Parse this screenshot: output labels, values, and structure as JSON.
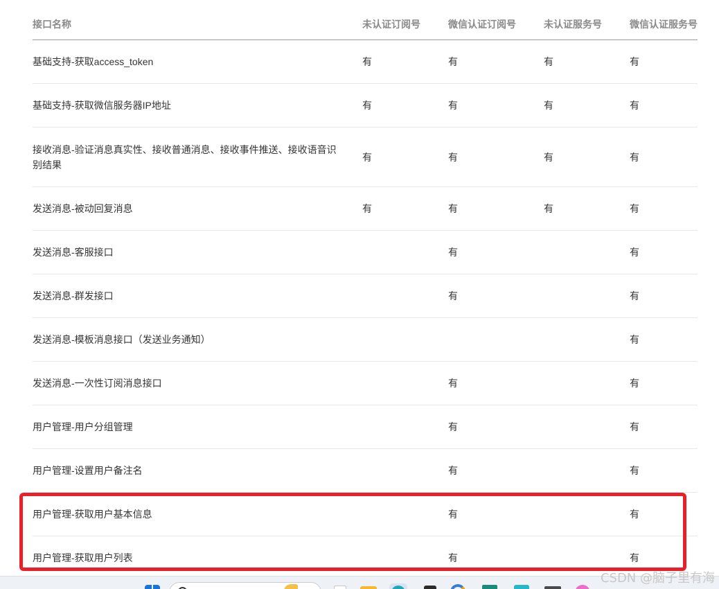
{
  "table": {
    "headers": [
      "接口名称",
      "未认证订阅号",
      "微信认证订阅号",
      "未认证服务号",
      "微信认证服务号"
    ],
    "rows": [
      {
        "name": "基础支持-获取access_token",
        "c1": "有",
        "c2": "有",
        "c3": "有",
        "c4": "有"
      },
      {
        "name": "基础支持-获取微信服务器IP地址",
        "c1": "有",
        "c2": "有",
        "c3": "有",
        "c4": "有"
      },
      {
        "name": "接收消息-验证消息真实性、接收普通消息、接收事件推送、接收语音识别结果",
        "c1": "有",
        "c2": "有",
        "c3": "有",
        "c4": "有"
      },
      {
        "name": "发送消息-被动回复消息",
        "c1": "有",
        "c2": "有",
        "c3": "有",
        "c4": "有"
      },
      {
        "name": "发送消息-客服接口",
        "c1": "",
        "c2": "有",
        "c3": "",
        "c4": "有"
      },
      {
        "name": "发送消息-群发接口",
        "c1": "",
        "c2": "有",
        "c3": "",
        "c4": "有"
      },
      {
        "name": "发送消息-模板消息接口（发送业务通知）",
        "c1": "",
        "c2": "",
        "c3": "",
        "c4": "有"
      },
      {
        "name": "发送消息-一次性订阅消息接口",
        "c1": "",
        "c2": "有",
        "c3": "",
        "c4": "有"
      },
      {
        "name": "用户管理-用户分组管理",
        "c1": "",
        "c2": "有",
        "c3": "",
        "c4": "有"
      },
      {
        "name": "用户管理-设置用户备注名",
        "c1": "",
        "c2": "有",
        "c3": "",
        "c4": "有"
      },
      {
        "name": "用户管理-获取用户基本信息",
        "c1": "",
        "c2": "有",
        "c3": "",
        "c4": "有"
      },
      {
        "name": "用户管理-获取用户列表",
        "c1": "",
        "c2": "有",
        "c3": "",
        "c4": "有"
      }
    ]
  },
  "annotation": {
    "highlight_color": "#e8202a"
  },
  "watermark": "CSDN @脑子里有海",
  "taskbar": {
    "icons": [
      "start-icon",
      "search-icon",
      "widget-icon",
      "file-icon",
      "folder-icon",
      "edge-browser-icon",
      "store-icon",
      "browser-icon",
      "ide-icon",
      "doc-icon",
      "terminal-icon",
      "chat-icon"
    ]
  }
}
